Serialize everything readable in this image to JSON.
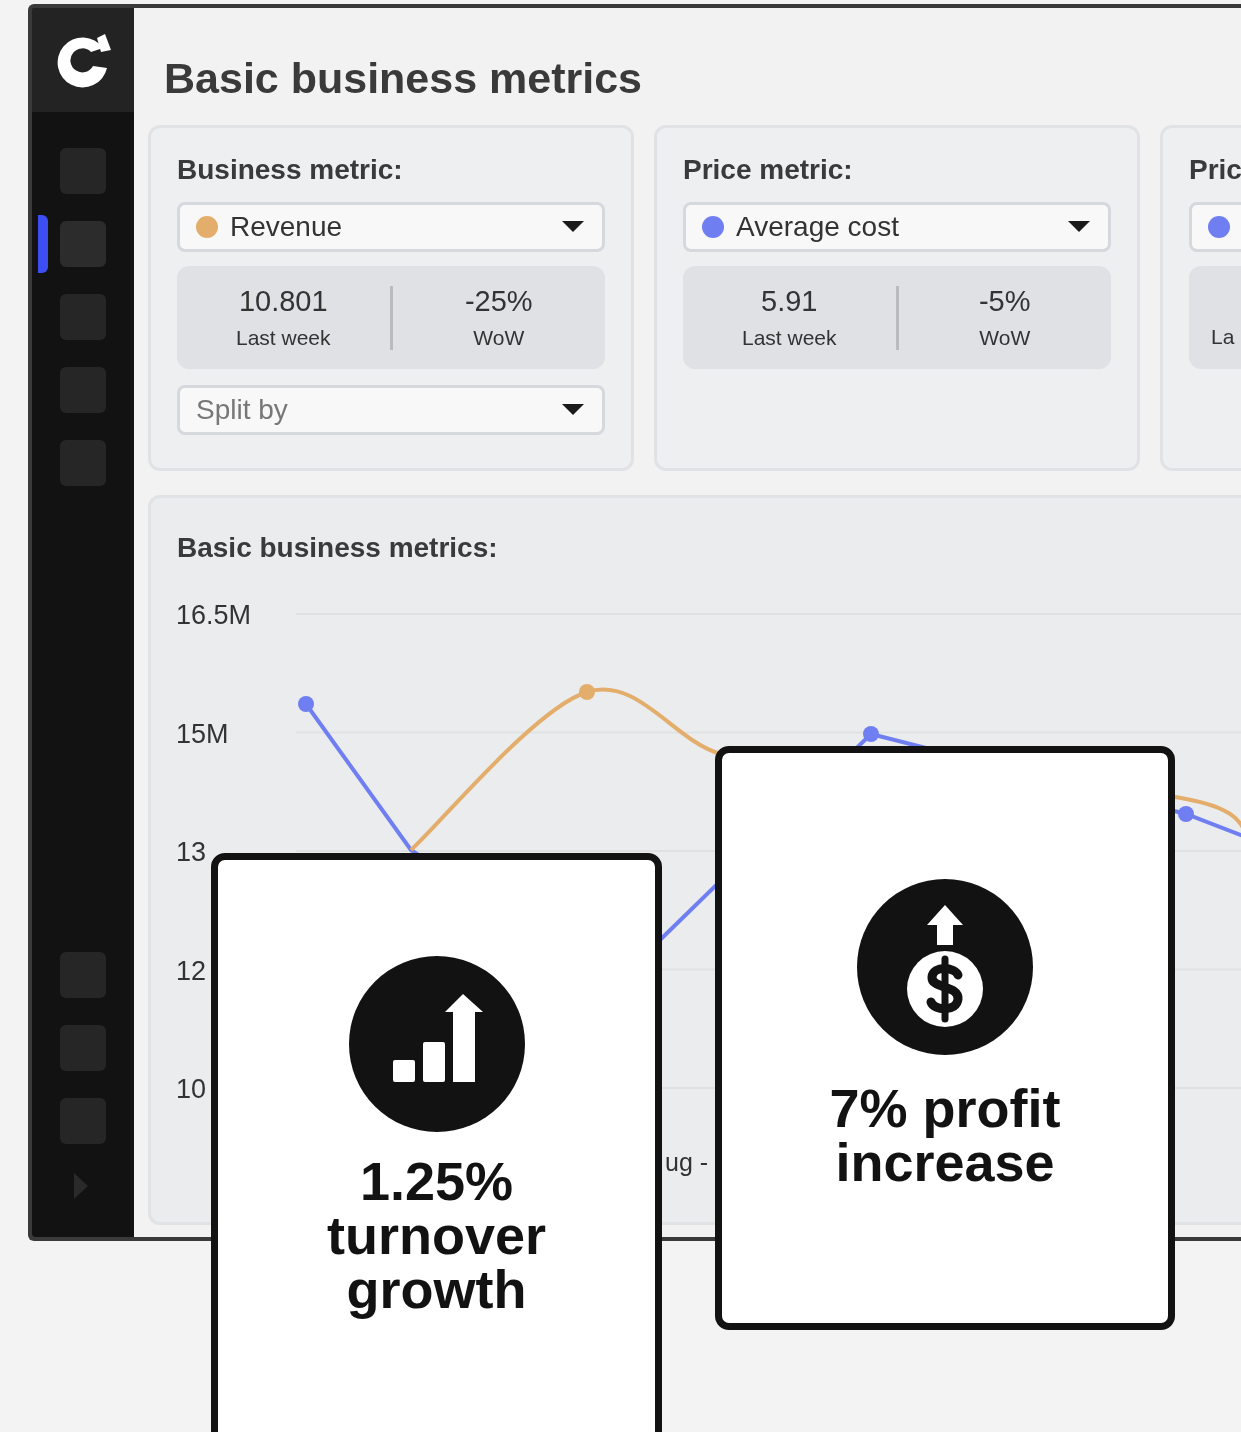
{
  "sidebar": {
    "items": [
      {
        "selected": false
      },
      {
        "selected": true
      },
      {
        "selected": false
      },
      {
        "selected": false
      },
      {
        "selected": false
      }
    ],
    "bottom_items": [
      {
        "selected": false
      },
      {
        "selected": false
      },
      {
        "selected": false
      }
    ]
  },
  "page_title": "Basic business metrics",
  "metric_cards": [
    {
      "title": "Business metric:",
      "selector": {
        "value": "Revenue",
        "color": "#e3ae6c"
      },
      "stats": [
        {
          "value": "10.801",
          "label": "Last week"
        },
        {
          "value": "-25%",
          "label": "WoW"
        }
      ],
      "split": {
        "placeholder": "Split by"
      }
    },
    {
      "title": "Price metric:",
      "selector": {
        "value": "Average cost",
        "color": "#6f7ff2"
      },
      "stats": [
        {
          "value": "5.91",
          "label": "Last week"
        },
        {
          "value": "-5%",
          "label": "WoW"
        }
      ]
    },
    {
      "title": "Pric",
      "selector": {
        "color": "#6f7ff2"
      },
      "stats": [
        {
          "label": "La"
        }
      ]
    }
  ],
  "chart": {
    "title": "Basic business metrics:",
    "y_axis_labels": [
      "16.5M",
      "15M",
      "13",
      "12",
      "10"
    ],
    "x_label_fragment": "ug -"
  },
  "highlights": [
    {
      "text": "1.25% turnover growth",
      "kind": "growth"
    },
    {
      "text": "7% profit increase",
      "kind": "profit"
    }
  ]
}
